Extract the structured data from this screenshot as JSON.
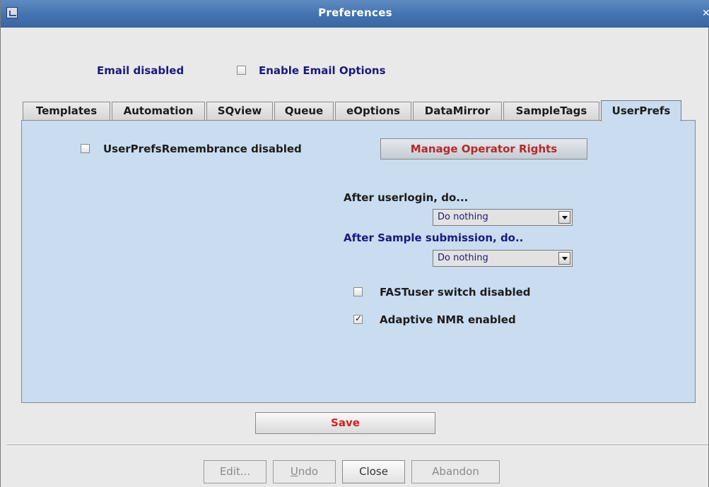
{
  "window": {
    "title": "Preferences",
    "close_glyph": "✕"
  },
  "email": {
    "status_label": "Email disabled",
    "enable_label": "Enable Email Options",
    "enable_checked": false
  },
  "tabs": [
    {
      "label": "Templates"
    },
    {
      "label": "Automation"
    },
    {
      "label": "SQview"
    },
    {
      "label": "Queue"
    },
    {
      "label": "eOptions"
    },
    {
      "label": "DataMirror"
    },
    {
      "label": "SampleTags"
    },
    {
      "label": "UserPrefs",
      "active": true
    }
  ],
  "userprefs": {
    "remembrance_label": "UserPrefsRemembrance disabled",
    "remembrance_checked": false,
    "manage_rights_label": "Manage Operator Rights",
    "after_login_label": "After userlogin, do...",
    "after_login_value": "Do nothing",
    "after_sample_label": "After Sample submission, do..",
    "after_sample_value": "Do nothing",
    "fastuser_label": "FASTuser switch disabled",
    "fastuser_checked": false,
    "adaptive_label": "Adaptive NMR enabled",
    "adaptive_checked": true
  },
  "save_label": "Save",
  "bottom_buttons": {
    "edit": "Edit...",
    "undo_mnemonic": "U",
    "undo_rest": "ndo",
    "close": "Close",
    "abandon": "Abandon"
  },
  "colors": {
    "titlebar": "#4a79b6",
    "panel": "#c9dcf0",
    "save_text": "#d42020",
    "manage_text": "#b52a2a",
    "label_blue": "#1a1a7e"
  }
}
